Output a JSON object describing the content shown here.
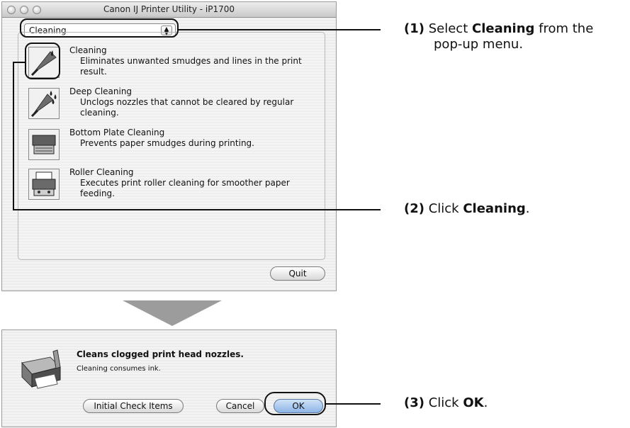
{
  "window": {
    "title": "Canon IJ Printer Utility - iP1700",
    "popup_value": "Cleaning",
    "items": [
      {
        "title": "Cleaning",
        "desc": "Eliminates unwanted smudges and lines in the print result.",
        "icon": "cleaning-icon"
      },
      {
        "title": "Deep Cleaning",
        "desc": "Unclogs nozzles that cannot be cleared by regular cleaning.",
        "icon": "deep-cleaning-icon"
      },
      {
        "title": "Bottom Plate Cleaning",
        "desc": "Prevents paper smudges during printing.",
        "icon": "bottom-plate-icon"
      },
      {
        "title": "Roller Cleaning",
        "desc": "Executes print roller cleaning for smoother paper feeding.",
        "icon": "roller-icon"
      }
    ],
    "quit_label": "Quit"
  },
  "dialog": {
    "message": "Cleans clogged print head nozzles.",
    "info": "Cleaning consumes ink.",
    "initial_label": "Initial Check Items",
    "cancel_label": "Cancel",
    "ok_label": "OK"
  },
  "callouts": {
    "step1_num": "(1)",
    "step1_pre": "Select",
    "step1_bold": "Cleaning",
    "step1_post": "from the",
    "step1_line2": "pop-up menu.",
    "step2_num": "(2)",
    "step2_pre": "Click",
    "step2_bold": "Cleaning",
    "step2_post": ".",
    "step3_num": "(3)",
    "step3_pre": "Click",
    "step3_bold": "OK",
    "step3_post": "."
  }
}
